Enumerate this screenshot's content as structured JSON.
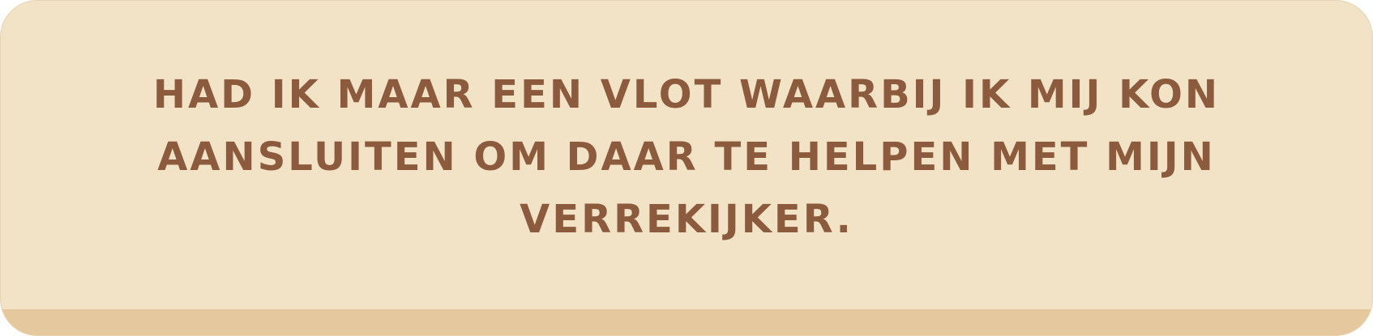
{
  "card": {
    "message": "HAD IK MAAR EEN VLOT WAARBIJ IK MIJ KON AANSLUITEN OM DAAR TE HELPEN MET MIJN VERREKIJKER."
  },
  "colors": {
    "card_background": "#f2e2c6",
    "card_bottom_band": "#e5c89d",
    "text": "#8c5a3c"
  }
}
